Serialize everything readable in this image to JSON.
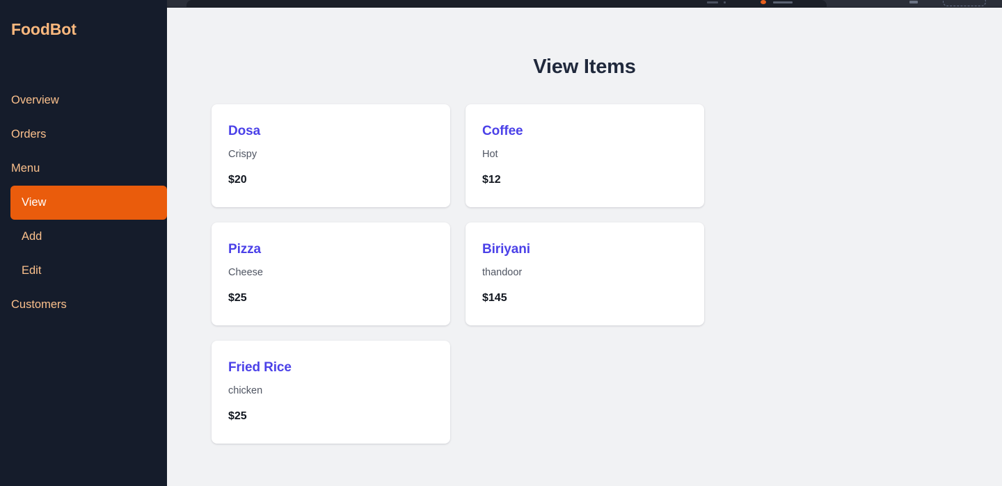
{
  "browser": {
    "tab_icons": [
      "minimize-icon",
      "extension-icon",
      "profile-chip"
    ]
  },
  "sidebar": {
    "brand": "FoodBot",
    "items": [
      {
        "label": "Overview",
        "active": false,
        "sub": false
      },
      {
        "label": "Orders",
        "active": false,
        "sub": false
      },
      {
        "label": "Menu",
        "active": false,
        "sub": false
      },
      {
        "label": "View",
        "active": true,
        "sub": true
      },
      {
        "label": "Add",
        "active": false,
        "sub": true
      },
      {
        "label": "Edit",
        "active": false,
        "sub": true
      },
      {
        "label": "Customers",
        "active": false,
        "sub": false
      }
    ],
    "colors": {
      "background": "#151c2b",
      "text": "#fbc08c",
      "brand": "#fbb87e",
      "active_background": "#ea5c0c",
      "active_text": "#ffffff"
    }
  },
  "main": {
    "title": "View Items",
    "background": "#f1f2f4",
    "title_color": "#20293c",
    "card_title_color": "#4b41e8",
    "items": [
      {
        "name": "Dosa",
        "description": "Crispy",
        "price": "$20"
      },
      {
        "name": "Coffee",
        "description": "Hot",
        "price": "$12"
      },
      {
        "name": "Pizza",
        "description": "Cheese",
        "price": "$25"
      },
      {
        "name": "Biriyani",
        "description": "thandoor",
        "price": "$145"
      },
      {
        "name": "Fried Rice",
        "description": "chicken",
        "price": "$25"
      }
    ]
  }
}
